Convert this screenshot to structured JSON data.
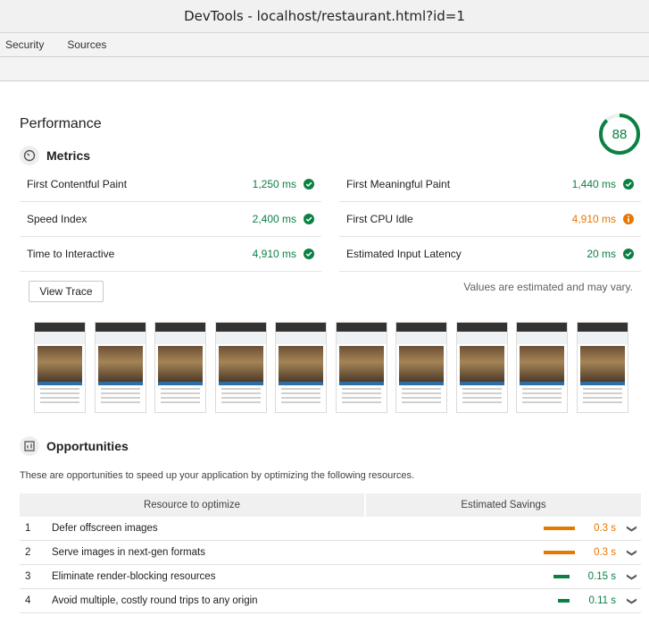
{
  "window": {
    "title": "DevTools - localhost/restaurant.html?id=1"
  },
  "tabs": [
    {
      "label": "Security"
    },
    {
      "label": "Sources"
    }
  ],
  "report": {
    "section_title": "Performance",
    "score": "88",
    "score_fraction": 0.88,
    "colors": {
      "pass": "#0b8043",
      "average": "#e67700"
    },
    "metrics_heading": "Metrics",
    "metrics": [
      {
        "name": "First Contentful Paint",
        "value": "1,250 ms",
        "status": "pass"
      },
      {
        "name": "First Meaningful Paint",
        "value": "1,440 ms",
        "status": "pass"
      },
      {
        "name": "Speed Index",
        "value": "2,400 ms",
        "status": "pass"
      },
      {
        "name": "First CPU Idle",
        "value": "4,910 ms",
        "status": "average"
      },
      {
        "name": "Time to Interactive",
        "value": "4,910 ms",
        "status": "pass"
      },
      {
        "name": "Estimated Input Latency",
        "value": "20 ms",
        "status": "pass"
      }
    ],
    "view_trace_label": "View Trace",
    "estimate_note": "Values are estimated and may vary.",
    "filmstrip_count": 10,
    "opportunities_heading": "Opportunities",
    "opportunities_description": "These are opportunities to speed up your application by optimizing the following resources.",
    "table_headers": {
      "resource": "Resource to optimize",
      "savings": "Estimated Savings"
    },
    "opportunities": [
      {
        "num": "1",
        "title": "Defer offscreen images",
        "savings": "0.3 s",
        "status": "average"
      },
      {
        "num": "2",
        "title": "Serve images in next-gen formats",
        "savings": "0.3 s",
        "status": "average"
      },
      {
        "num": "3",
        "title": "Eliminate render-blocking resources",
        "savings": "0.15 s",
        "status": "pass"
      },
      {
        "num": "4",
        "title": "Avoid multiple, costly round trips to any origin",
        "savings": "0.11 s",
        "status": "pass"
      }
    ],
    "icons": {
      "metrics": "timer-icon",
      "opportunities": "opportunities-icon",
      "pass": "check-circle-icon",
      "average": "info-circle-icon",
      "expand": "chevron-down-icon"
    }
  }
}
